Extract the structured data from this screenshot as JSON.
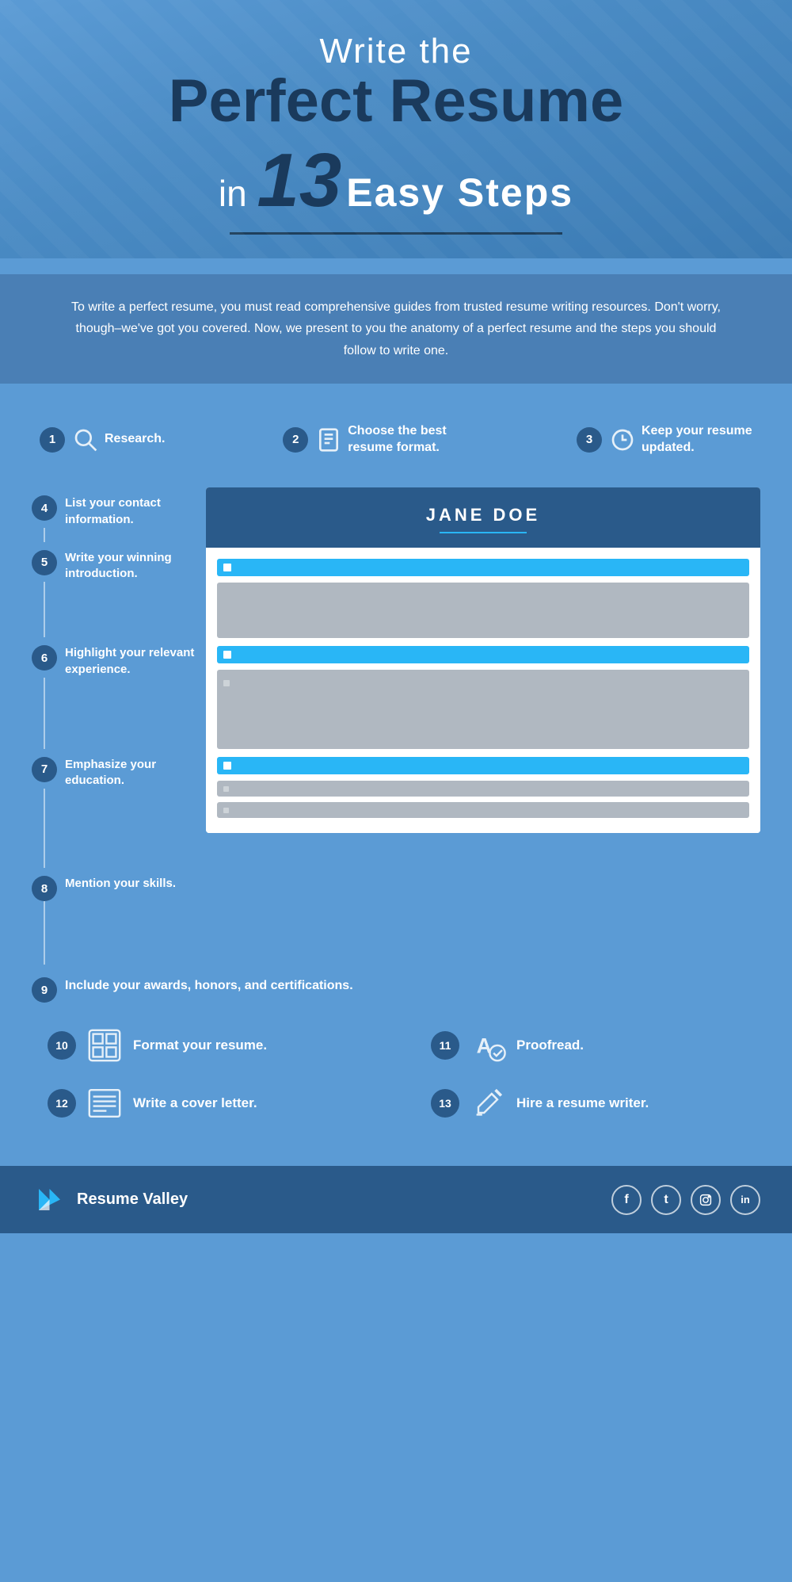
{
  "header": {
    "line1": "Write the",
    "line2": "Perfect Resume",
    "line3_prefix": "in ",
    "line3_number": "13",
    "line3_suffix": "Easy Steps"
  },
  "intro": {
    "text": "To write a perfect resume, you must read comprehensive guides from trusted resume writing resources. Don't worry, though–we've got you covered. Now, we present to you the anatomy of a perfect resume and the steps you should follow to write one."
  },
  "steps": [
    {
      "num": "1",
      "label": "Research.",
      "icon": "search"
    },
    {
      "num": "2",
      "label": "Choose the best resume format.",
      "icon": "doc"
    },
    {
      "num": "3",
      "label": "Keep your resume updated.",
      "icon": "clock"
    },
    {
      "num": "4",
      "label": "List your contact information.",
      "icon": ""
    },
    {
      "num": "5",
      "label": "Write your winning introduction.",
      "icon": ""
    },
    {
      "num": "6",
      "label": "Highlight your relevant experience.",
      "icon": ""
    },
    {
      "num": "7",
      "label": "Emphasize your education.",
      "icon": ""
    },
    {
      "num": "8",
      "label": "Mention your skills.",
      "icon": ""
    },
    {
      "num": "9",
      "label": "Include your awards, honors, and certifications.",
      "icon": ""
    },
    {
      "num": "10",
      "label": "Format your resume.",
      "icon": "resume-fmt"
    },
    {
      "num": "11",
      "label": "Proofread.",
      "icon": "proofread"
    },
    {
      "num": "12",
      "label": "Write a cover letter.",
      "icon": "cover"
    },
    {
      "num": "13",
      "label": "Hire a resume writer.",
      "icon": "writer"
    }
  ],
  "resume_mock": {
    "name": "JANE DOE"
  },
  "footer": {
    "brand": "Resume Valley",
    "social": [
      "f",
      "t",
      "📷",
      "in"
    ]
  }
}
